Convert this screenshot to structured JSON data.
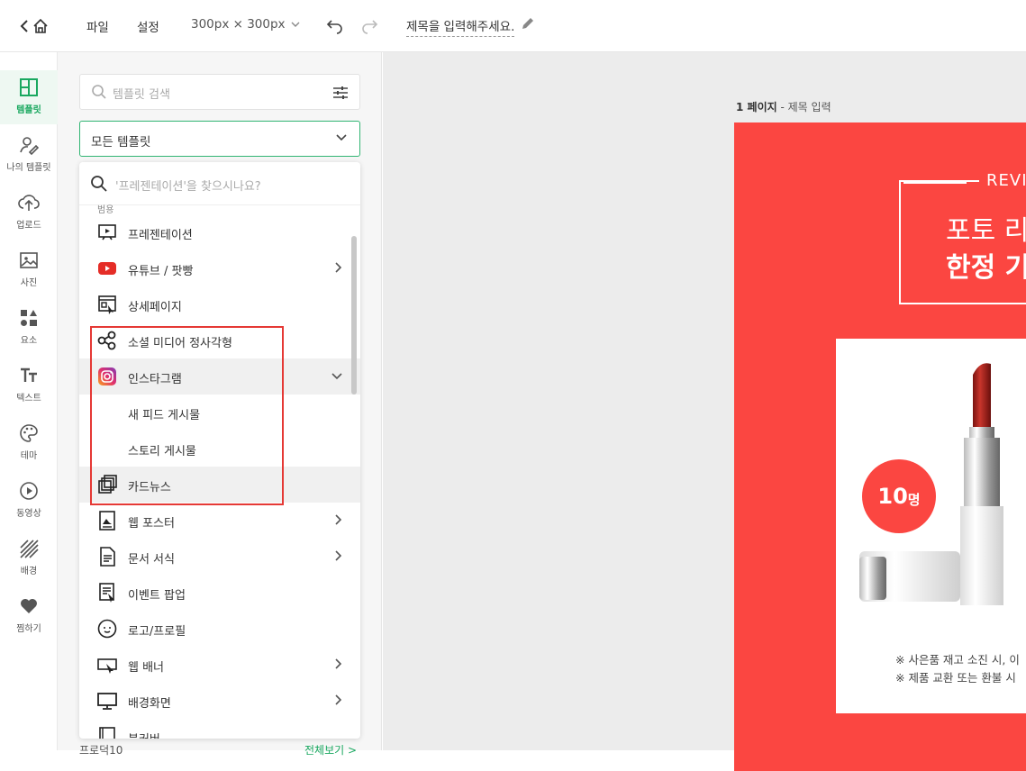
{
  "topbar": {
    "menu_file": "파일",
    "menu_settings": "설정",
    "size": "300px × 300px",
    "title": "제목을 입력해주세요."
  },
  "rail": [
    {
      "label": "템플릿",
      "icon": "layout-icon",
      "active": true
    },
    {
      "label": "나의 템플릿",
      "icon": "user-edit-icon"
    },
    {
      "label": "업로드",
      "icon": "cloud-upload-icon"
    },
    {
      "label": "사진",
      "icon": "image-icon"
    },
    {
      "label": "요소",
      "icon": "shapes-icon"
    },
    {
      "label": "텍스트",
      "icon": "text-icon"
    },
    {
      "label": "테마",
      "icon": "palette-icon"
    },
    {
      "label": "동영상",
      "icon": "play-icon"
    },
    {
      "label": "배경",
      "icon": "pattern-icon"
    },
    {
      "label": "찜하기",
      "icon": "heart-icon"
    }
  ],
  "panel": {
    "search_placeholder": "템플릿 검색",
    "select_value": "모든 템플릿",
    "dropdown_search_placeholder": "'프레젠테이션'을 찾으시나요?",
    "category_label": "범용",
    "items": [
      {
        "label": "프레젠테이션",
        "icon": "presentation-icon",
        "arrow": false
      },
      {
        "label": "유튜브 / 팟빵",
        "icon": "youtube-icon",
        "arrow": true
      },
      {
        "label": "상세페이지",
        "icon": "detail-page-icon",
        "arrow": false
      },
      {
        "label": "소셜 미디어 정사각형",
        "icon": "share-icon",
        "arrow": false
      },
      {
        "label": "인스타그램",
        "icon": "instagram-icon",
        "arrow": true,
        "expanded": true
      },
      {
        "label": "새 피드 게시물",
        "sub": true
      },
      {
        "label": "스토리 게시물",
        "sub": true
      },
      {
        "label": "카드뉴스",
        "icon": "card-news-icon",
        "arrow": false
      },
      {
        "label": "웹 포스터",
        "icon": "poster-icon",
        "arrow": true
      },
      {
        "label": "문서 서식",
        "icon": "document-icon",
        "arrow": true
      },
      {
        "label": "이벤트 팝업",
        "icon": "event-popup-icon",
        "arrow": false
      },
      {
        "label": "로고/프로필",
        "icon": "logo-icon",
        "arrow": false
      },
      {
        "label": "웹 배너",
        "icon": "web-banner-icon",
        "arrow": true
      },
      {
        "label": "배경화면",
        "icon": "monitor-icon",
        "arrow": true
      },
      {
        "label": "북커버",
        "icon": "book-icon",
        "arrow": false
      }
    ],
    "footer_left": "프로덕10",
    "footer_right": "전체보기 >"
  },
  "canvas": {
    "page_number": "1 페이지",
    "page_title": "제목 입력",
    "review": "REVIE",
    "headline1": "포토 리",
    "headline2": "한정 기",
    "badge_number": "10",
    "badge_unit": "명",
    "note1": "※ 사은품 재고 소진 시, 이",
    "note2": "※ 제품 교환 또는 환불 시"
  },
  "colors": {
    "accent": "#1aa860",
    "design_red": "#fb4641",
    "highlight_box": "#e53935"
  }
}
